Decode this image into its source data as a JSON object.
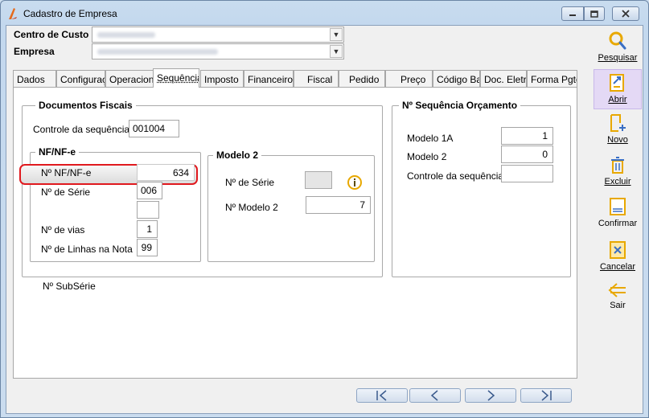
{
  "window": {
    "title": "Cadastro de Empresa",
    "min_icon": "minimize-icon",
    "max_icon": "maximize-icon",
    "close_icon": "close-icon"
  },
  "header": {
    "centro_label": "Centro de Custo",
    "empresa_label": "Empresa"
  },
  "tabs": [
    {
      "label": "Dados"
    },
    {
      "label": "Configuraç"
    },
    {
      "label": "Operaciona"
    },
    {
      "label": "Sequência"
    },
    {
      "label": "Imposto"
    },
    {
      "label": "Financeiro"
    },
    {
      "label": "Fiscal"
    },
    {
      "label": "Pedido"
    },
    {
      "label": "Preço"
    },
    {
      "label": "Código Bar"
    },
    {
      "label": "Doc. Eletrô"
    },
    {
      "label": "Forma Pgto"
    }
  ],
  "documentos": {
    "title": "Documentos Fiscais",
    "controle_label": "Controle da sequência",
    "controle_value": "001004"
  },
  "nfe": {
    "title": "NF/NF-e",
    "numero_label": "Nº NF/NF-e",
    "numero_value": "634",
    "serie_label": "Nº de Série",
    "serie_value": "006",
    "subserie_label": "Nº SubSérie",
    "subserie_value": "",
    "vias_label": "Nº de vias",
    "vias_value": "1",
    "linhas_label": "Nº de Linhas na Nota",
    "linhas_value": "99"
  },
  "modelo2": {
    "title": "Modelo 2",
    "serie_label": "Nº de Série",
    "serie_value": "",
    "numero_label": "Nº Modelo 2",
    "numero_value": "7",
    "info_icon": "info-icon"
  },
  "orcamento": {
    "title": "Nº Sequência Orçamento",
    "modelo1a_label": "Modelo 1A",
    "modelo1a_value": "1",
    "modelo2_label": "Modelo 2",
    "modelo2_value": "0",
    "controle_label": "Controle da sequência",
    "controle_value": ""
  },
  "toolbar": {
    "pesquisar": "Pesquisar",
    "abrir": "Abrir",
    "novo": "Novo",
    "excluir": "Excluir",
    "confirmar": "Confirmar",
    "cancelar": "Cancelar",
    "sair": "Sair"
  },
  "colors": {
    "highlight": "#e0191e",
    "icon_accent": "#e8a800",
    "icon_blue": "#3a6fc4"
  }
}
